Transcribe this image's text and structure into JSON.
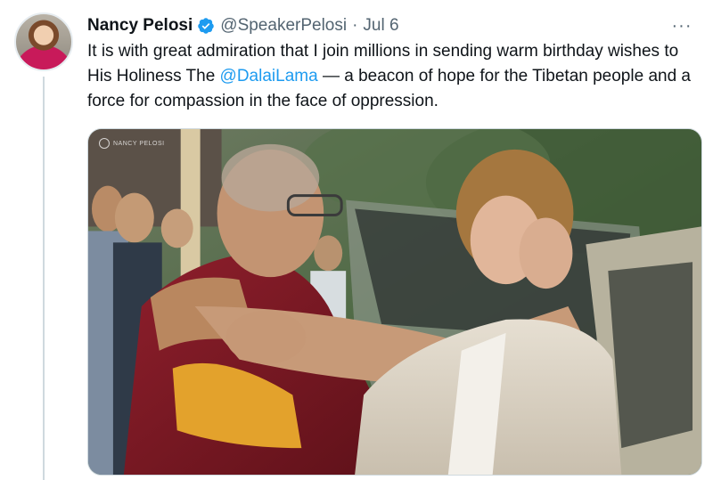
{
  "author": {
    "name": "Nancy Pelosi",
    "handle": "@SpeakerPelosi",
    "separator": "·",
    "date": "Jul 6",
    "verified": true,
    "avatar_icon": "profile-photo"
  },
  "tweet": {
    "text_before": "It is with great admiration that I join millions in sending warm birthday wishes to His Holiness The ",
    "mention": "@DalaiLama",
    "text_after": " — a beacon of hope for the Tibetan people and a force for compassion in the face of oppression."
  },
  "media": {
    "watermark": "NANCY PELOSI",
    "description_icon": "photo"
  },
  "menu": {
    "more_label": "···"
  },
  "colors": {
    "link": "#1d9bf0",
    "verified": "#1d9bf0",
    "secondary_text": "#536471",
    "thread_line": "#cfd9de"
  }
}
